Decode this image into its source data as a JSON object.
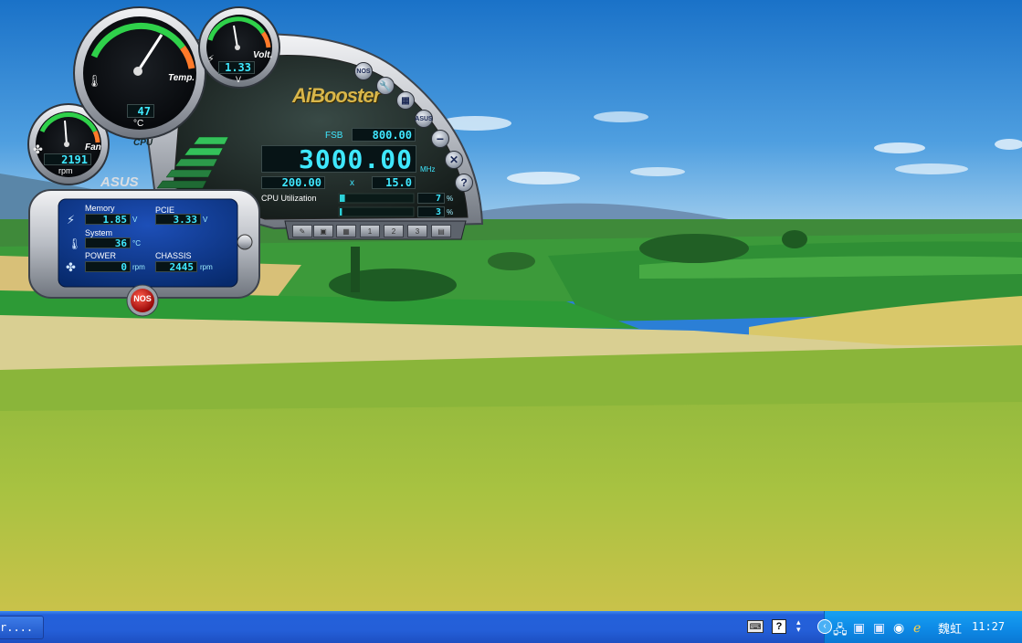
{
  "widget": {
    "title": "AiBooster",
    "brand": "ASUS",
    "gauges": {
      "cpu": {
        "value": "47",
        "unit": "°C",
        "label": "Temp.",
        "caption": "CPU",
        "level": 0.5
      },
      "volt": {
        "value": "1.33",
        "unit": "V",
        "label": "Volt.",
        "level": 0.45
      },
      "fan": {
        "value": "2191",
        "unit": "rpm",
        "label": "Fan",
        "level": 0.48
      }
    },
    "fsb": {
      "label": "FSB",
      "value": "800.00"
    },
    "cpu_freq": {
      "value": "3000.00",
      "unit": "MHz"
    },
    "base_clock": "200.00",
    "multiplier_sign": "x",
    "multiplier": "15.0",
    "cpu_utilization": {
      "label": "CPU Utilization",
      "core1": "7",
      "core2": "3",
      "unit": "%"
    },
    "side_buttons": [
      "NOS",
      "ASUS"
    ],
    "panel": {
      "memory_label": "Memory",
      "memory_value": "1.85",
      "memory_unit": "V",
      "pcie_label": "PCIE",
      "pcie_value": "3.33",
      "pcie_unit": "V",
      "system_label": "System",
      "system_value": "36",
      "system_unit": "°C",
      "power_label": "POWER",
      "power_value": "0",
      "power_unit": "rpm",
      "chassis_label": "CHASSIS",
      "chassis_value": "2445",
      "chassis_unit": "rpm"
    },
    "nos_button": "NOS",
    "toolbar_buttons": [
      "1",
      "2",
      "3"
    ]
  },
  "taskbar": {
    "task_label": "r....",
    "tray_user": "魏虹",
    "clock": "11:27"
  },
  "colors": {
    "lcd_text": "#3fe8ff",
    "taskbar": "#245fd8",
    "tray": "#0e8ae6",
    "widget_green": "#34c15a"
  }
}
